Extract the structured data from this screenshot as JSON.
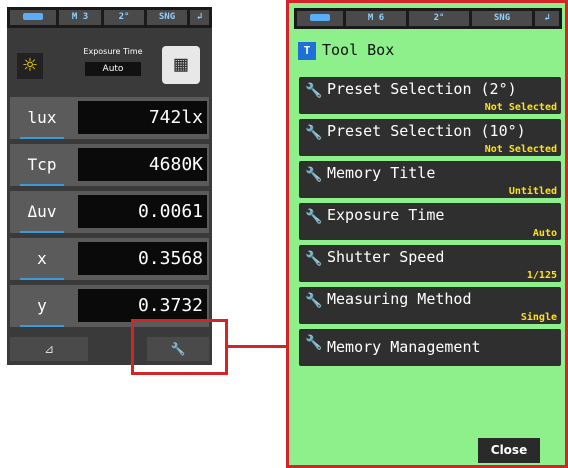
{
  "status_bar": {
    "left_memory": "M 3",
    "right_memory": "M 6",
    "angle": "2°",
    "mode": "SNG"
  },
  "left_screen": {
    "exposure_title": "Exposure Time",
    "exposure_value": "Auto",
    "rows": [
      {
        "label": "lux",
        "value": "742lx"
      },
      {
        "label": "Tcp",
        "value": "4680K"
      },
      {
        "label": "Δuv",
        "value": "0.0061"
      },
      {
        "label": "x",
        "value": "0.3568"
      },
      {
        "label": "y",
        "value": "0.3732"
      }
    ],
    "bottom_left_icon": "delta-icon",
    "bottom_right_icon": "wrench-icon"
  },
  "right_screen": {
    "title": "Tool Box",
    "items": [
      {
        "label": "Preset Selection (2°)",
        "value": "Not Selected"
      },
      {
        "label": "Preset Selection (10°)",
        "value": "Not Selected"
      },
      {
        "label": "Memory Title",
        "value": "Untitled"
      },
      {
        "label": "Exposure Time",
        "value": "Auto"
      },
      {
        "label": "Shutter Speed",
        "value": "1/125"
      },
      {
        "label": "Measuring Method",
        "value": "Single"
      },
      {
        "label": "Memory Management",
        "value": ""
      }
    ],
    "close_label": "Close"
  },
  "colors": {
    "highlight": "#d2242b",
    "toolbox_bg": "#8ef08a",
    "value_yellow": "#ffe21c",
    "accent_blue": "#3b9bd8"
  }
}
